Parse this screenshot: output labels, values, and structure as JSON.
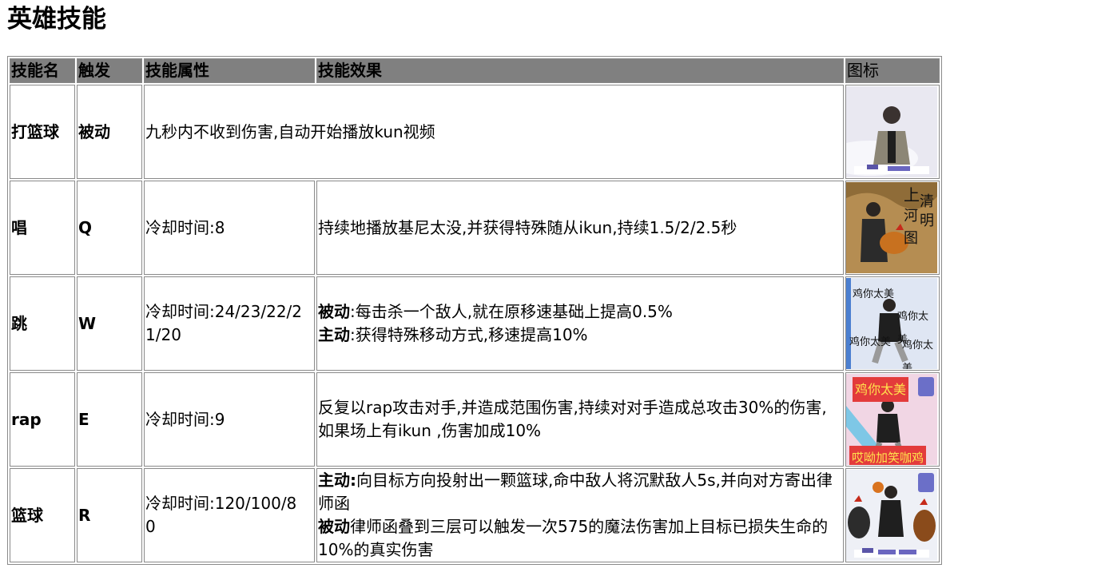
{
  "page_title": "英雄技能",
  "table": {
    "headers": [
      "技能名",
      "触发",
      "技能属性",
      "技能效果",
      "图标"
    ],
    "rows": [
      {
        "name": "打篮球",
        "trigger": "被动",
        "effect": "九秒内不收到伤害,自动开始播放kun视频",
        "icon": "passive-basketball-icon"
      },
      {
        "name": "唱",
        "trigger": "Q",
        "attr": "冷却时间:8",
        "effect": "持续地播放基尼太没,并获得特殊随从ikun,持续1.5/2/2.5秒",
        "icon": "sing-skill-icon",
        "icon_text": [
          "上",
          "清",
          "明",
          "河",
          "图"
        ]
      },
      {
        "name": "跳",
        "trigger": "W",
        "attr": "冷却时间:24/23/22/21/20",
        "effect": {
          "passive_label": "被动",
          "passive_text": ":每击杀一个敌人,就在原移速基础上提高0.5%",
          "active_label": "主动",
          "active_text": ":获得特殊移动方式,移速提高10%"
        },
        "icon": "jump-skill-icon",
        "icon_text": [
          "鸡你太美",
          "鸡你太美",
          "鸡你太美",
          "鸡你太美"
        ]
      },
      {
        "name": "rap",
        "trigger": "E",
        "attr": "冷却时间:9",
        "effect": "反复以rap攻击对手,并造成范围伤害,持续对对手造成总攻击30%的伤害,如果场上有ikun ,伤害加成10%",
        "icon": "rap-skill-icon",
        "icon_text": [
          "鸡你太美",
          "哎呦加笑咖鸡"
        ]
      },
      {
        "name": "篮球",
        "trigger": "R",
        "attr": "冷却时间:120/100/80",
        "effect": {
          "active_label": "主动:",
          "active_text": "向目标方向投射出一颗篮球,命中敌人将沉默敌人5s,并向对方寄出律师函",
          "passive_label": "被动",
          "passive_text": "律师函叠到三层可以触发一次575的魔法伤害加上目标已损失生命的10%的真实伤害"
        },
        "icon": "basketball-ult-icon"
      }
    ]
  }
}
